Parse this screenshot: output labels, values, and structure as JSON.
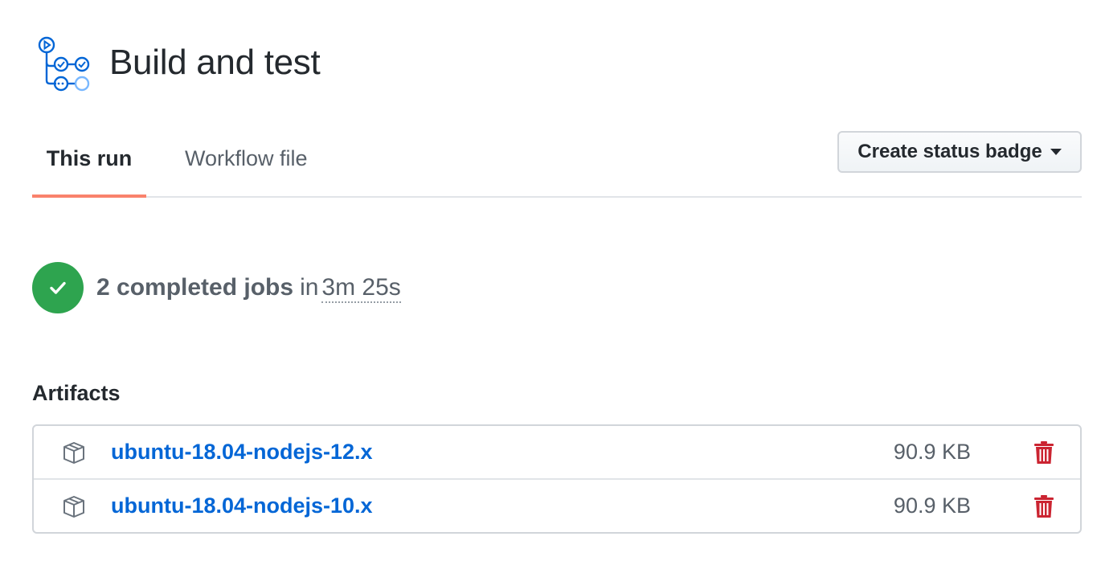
{
  "header": {
    "title": "Build and test",
    "icon": "workflow-icon"
  },
  "tabs": [
    {
      "label": "This run",
      "selected": true
    },
    {
      "label": "Workflow file",
      "selected": false
    }
  ],
  "status_badge_button": {
    "label": "Create status badge",
    "icon": "caret-down-icon"
  },
  "summary": {
    "status": "success",
    "status_color": "#2ea44f",
    "jobs_text": "2 completed jobs",
    "in_text": "in",
    "duration": "3m 25s"
  },
  "artifacts": {
    "title": "Artifacts",
    "items": [
      {
        "name": "ubuntu-18.04-nodejs-12.x",
        "size": "90.9 KB",
        "icon": "package-icon",
        "action_icon": "trash-icon"
      },
      {
        "name": "ubuntu-18.04-nodejs-10.x",
        "size": "90.9 KB",
        "icon": "package-icon",
        "action_icon": "trash-icon"
      }
    ]
  },
  "colors": {
    "link": "#0366d6",
    "tab_underline": "#f9826c",
    "danger": "#cb2431",
    "muted_text": "#586069"
  }
}
